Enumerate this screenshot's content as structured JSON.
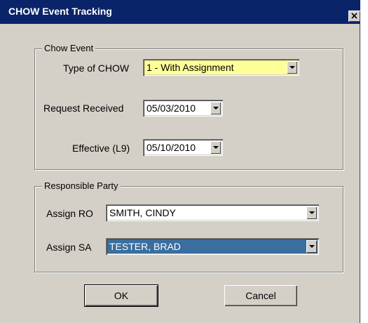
{
  "window": {
    "title": "CHOW Event Tracking"
  },
  "chow_event": {
    "legend": "Chow Event",
    "type_label": "Type of CHOW",
    "type_value": "1 - With Assignment",
    "request_label": "Request Received",
    "request_value": "05/03/2010",
    "effective_label": "Effective (L9)",
    "effective_value": "05/10/2010"
  },
  "responsible_party": {
    "legend": "Responsible Party",
    "ro_label": "Assign RO",
    "ro_value": "SMITH, CINDY",
    "sa_label": "Assign SA",
    "sa_value": "TESTER, BRAD"
  },
  "buttons": {
    "ok": "OK",
    "cancel": "Cancel"
  },
  "colors": {
    "titlebar": "#0a246a",
    "dialog_bg": "#d4d0c8",
    "highlight_field": "#ffff99",
    "selected_field": "#3a6e9e"
  },
  "icons": {
    "close": "close-icon",
    "dropdown": "chevron-down-icon"
  }
}
